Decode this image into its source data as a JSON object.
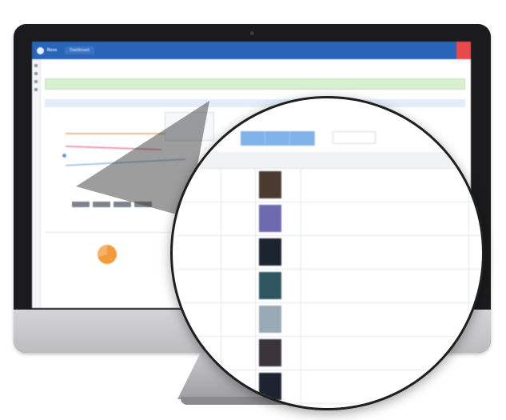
{
  "navbar": {
    "brand": "Revo",
    "section": "Dashboard",
    "items": [
      "",
      "",
      "",
      "",
      ""
    ],
    "alert_label": ""
  },
  "page": {
    "heading": "",
    "alert_text": "",
    "panel_title": "",
    "panel2_title": "",
    "pie_label": ""
  },
  "toolbar": {
    "buttons": [
      "",
      "",
      ""
    ],
    "text": "",
    "select_value": ""
  },
  "table": {
    "headers": [
      "",
      "",
      ""
    ],
    "rows": [
      {
        "id": "",
        "value": "",
        "link": "",
        "action": "",
        "thumb_color": "#4a3a30"
      },
      {
        "id": "",
        "value": "",
        "link": "",
        "action": "",
        "thumb_color": "#6f6ab0"
      },
      {
        "id": "",
        "value": "",
        "link": "",
        "action": "",
        "thumb_color": "#1c2430"
      },
      {
        "id": "",
        "value": "",
        "link": "",
        "action": "",
        "thumb_color": "#2f5560"
      },
      {
        "id": "",
        "value": "",
        "link": "",
        "action": "",
        "thumb_color": "#9aa9b6"
      },
      {
        "id": "",
        "value": "",
        "link": "",
        "action": "",
        "thumb_color": "#3a3438"
      },
      {
        "id": "",
        "value": "",
        "link": "",
        "action": "",
        "thumb_color": "#1d2330"
      }
    ]
  },
  "colors": {
    "navbar": "#2a64b7",
    "accent_button": "#7fb3ea",
    "alert_button": "#e8494a",
    "success_bar": "#d8efd0",
    "link": "#6fa4dc"
  }
}
